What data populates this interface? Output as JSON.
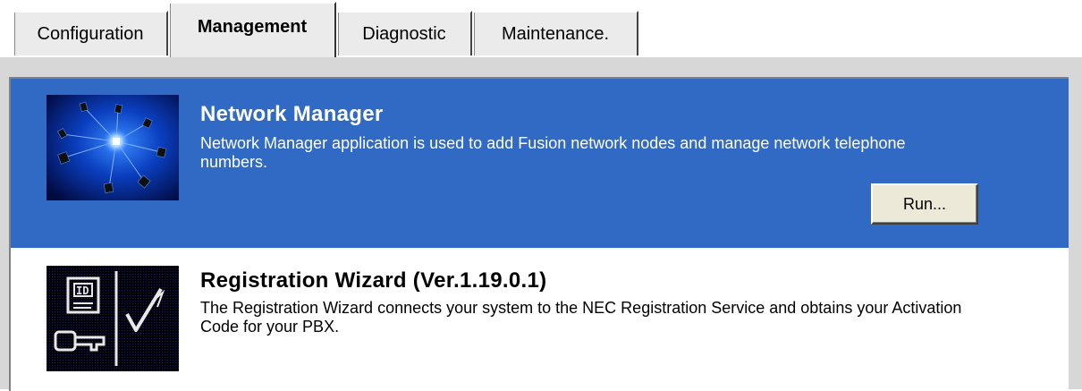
{
  "tabs": [
    {
      "label": "Configuration",
      "active": false
    },
    {
      "label": "Management",
      "active": true
    },
    {
      "label": "Diagnostic",
      "active": false
    },
    {
      "label": "Maintenance.",
      "active": false
    }
  ],
  "items": [
    {
      "title": "Network Manager",
      "description": "Network Manager application is used to add Fusion network nodes and manage network telephone numbers.",
      "button": "Run...",
      "selected": true,
      "icon": "network-nodes-icon"
    },
    {
      "title": "Registration Wizard (Ver.1.19.0.1)",
      "description": "The Registration Wizard connects your system to the NEC Registration Service and obtains your Activation Code for your PBX.",
      "selected": false,
      "icon": "registration-key-icon"
    }
  ],
  "colors": {
    "selection": "#316ac5",
    "frame": "#d7d7d7",
    "tab_face": "#ebebeb"
  }
}
